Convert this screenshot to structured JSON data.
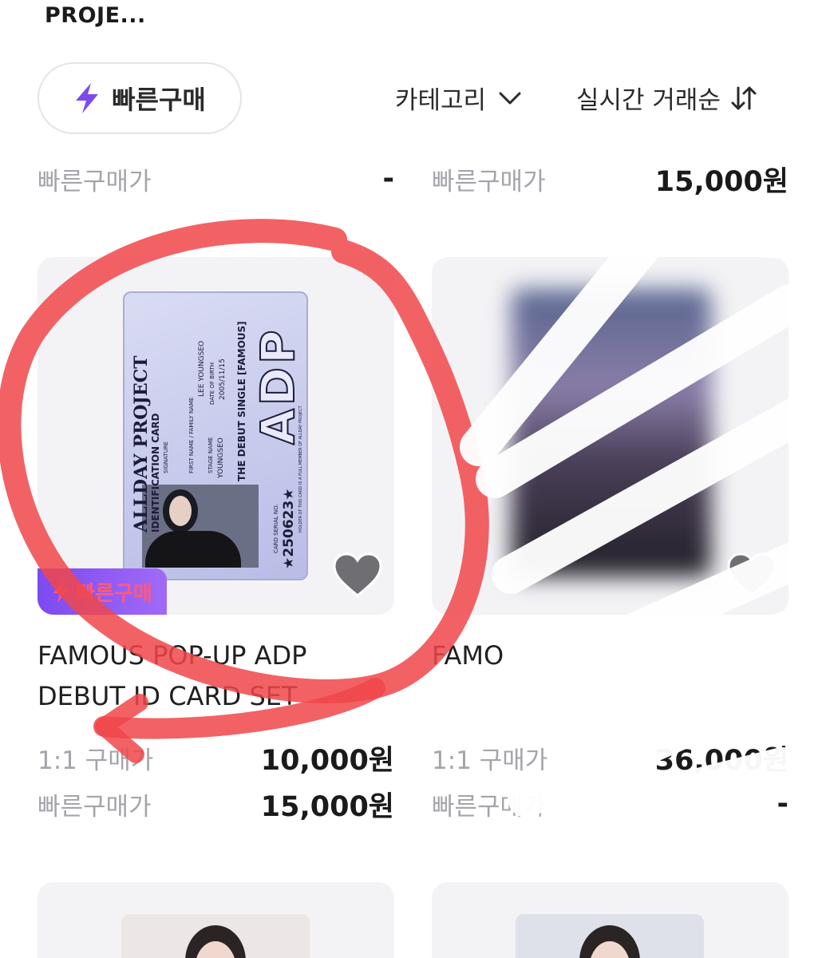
{
  "header": {
    "title": "PROJE..."
  },
  "toolbar": {
    "quick_buy_label": "빠른구매",
    "category_label": "카테고리",
    "sort_label": "실시간 거래순"
  },
  "top_prices": [
    {
      "label": "빠른구매가",
      "value": "-"
    },
    {
      "label": "빠른구매가",
      "value": "15,000원"
    }
  ],
  "products": [
    {
      "name_line1": "FAMOUS POP-UP ADP",
      "name_line2": "DEBUT ID CARD SET",
      "badge": "빠른구매",
      "price_1to1_label": "1:1 구매가",
      "price_1to1": "10,000원",
      "price_quick_label": "빠른구매가",
      "price_quick": "15,000원",
      "card": {
        "brand": "ALLDAY PROJECT",
        "card_title": "IDENTIFICATION CARD",
        "first_name": "LEE YOUNGSEO",
        "stage_name": "YOUNGSEO",
        "date_of_birth": "2005/11/15",
        "single": "THE DEBUT SINGLE [FAMOUS]",
        "logo": "ADP",
        "serial": "★250623★",
        "field_signature": "SIGNATURE",
        "field_first": "FIRST NAME / FAMILY NAME",
        "field_dob": "DATE OF BIRTH",
        "field_stage": "STAGE NAME",
        "field_serial": "CARD SERIAL NO.",
        "holder_note": "HOLDER OF THIS CARD IS A FULL MEMBER OF ALLDAY PROJECT"
      }
    },
    {
      "name_line1": "FAMO",
      "price_1to1_label": "1:1 구매가",
      "price_1to1": "36,000원",
      "price_quick_label": "빠른구매가",
      "price_quick": "-"
    }
  ],
  "colors": {
    "accent_purple": "#7d4af0",
    "badge_text": "#ff5a7a",
    "annotation_red": "#f0474a",
    "muted_text": "#a4a4aa"
  },
  "icons": {
    "quick_buy": "lightning-bolt-icon",
    "category": "chevron-down-icon",
    "sort": "sort-arrows-icon",
    "favorite": "heart-icon"
  }
}
